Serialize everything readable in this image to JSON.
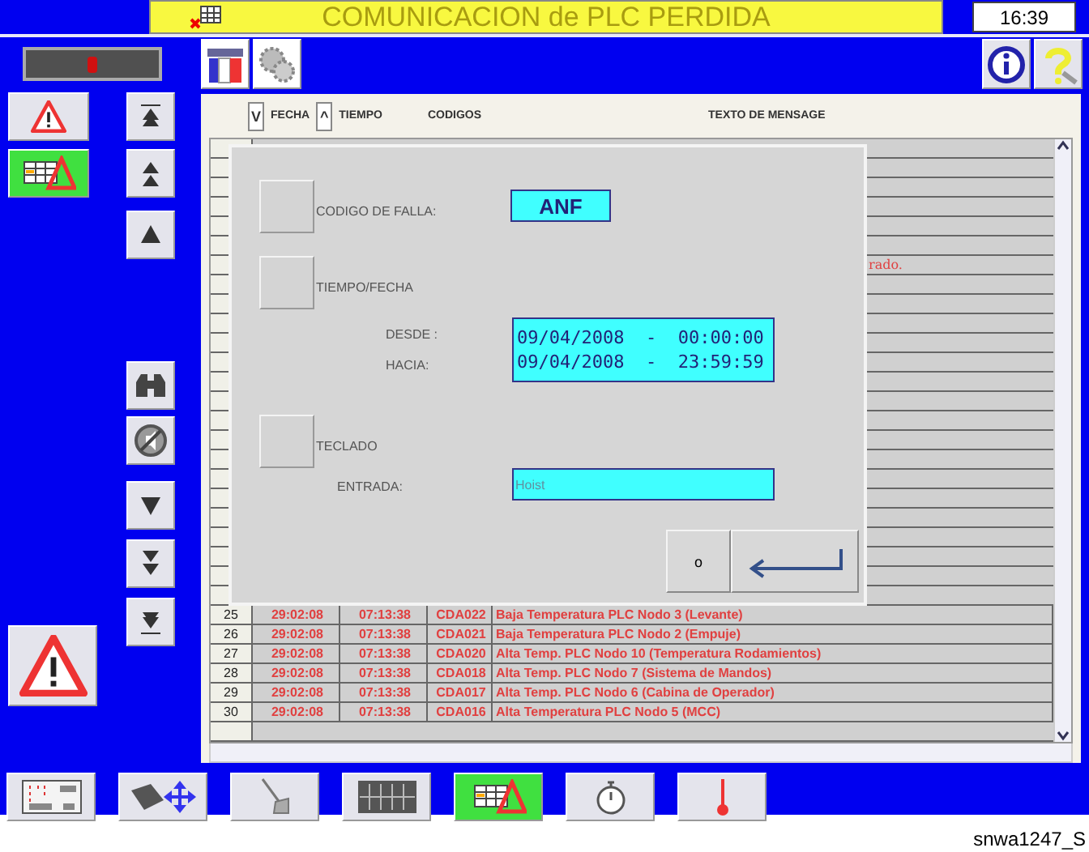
{
  "title_bar": {
    "title": "COMUNICACION de PLC PERDIDA",
    "clock": "16:39"
  },
  "nav": {
    "left": [
      {
        "kind": "warning",
        "selected": false
      },
      {
        "kind": "log",
        "selected": true
      }
    ],
    "arrows": [
      {
        "kind": "first"
      },
      {
        "kind": "page-up"
      },
      {
        "kind": "up"
      },
      {
        "kind": "binoculars"
      },
      {
        "kind": "mute"
      },
      {
        "kind": "down"
      },
      {
        "kind": "page-down"
      },
      {
        "kind": "last"
      }
    ],
    "alarm": {
      "kind": "big-warning"
    }
  },
  "toolbar": {
    "left": [
      {
        "kind": "flag"
      },
      {
        "kind": "gears"
      }
    ],
    "right": [
      {
        "kind": "info"
      },
      {
        "kind": "help"
      }
    ]
  },
  "table": {
    "columns": [
      {
        "sort": "V",
        "label": "FECHA"
      },
      {
        "sort": "^",
        "label": "TIEMPO"
      },
      {
        "label": "CODIGOS"
      },
      {
        "label": "TEXTO DE MENSAGE"
      }
    ],
    "obscured_tail": "rado.",
    "rows": [
      {
        "n": "25",
        "date": "29:02:08",
        "time": "07:13:38",
        "code": "CDA022",
        "text": "Baja Temperatura PLC Nodo 3 (Levante)"
      },
      {
        "n": "26",
        "date": "29:02:08",
        "time": "07:13:38",
        "code": "CDA021",
        "text": "Baja Temperatura PLC Nodo 2 (Empuje)"
      },
      {
        "n": "27",
        "date": "29:02:08",
        "time": "07:13:38",
        "code": "CDA020",
        "text": "Alta Temp. PLC Nodo 10 (Temperatura Rodamientos)"
      },
      {
        "n": "28",
        "date": "29:02:08",
        "time": "07:13:38",
        "code": "CDA018",
        "text": "Alta Temp. PLC Nodo 7 (Sistema de Mandos)"
      },
      {
        "n": "29",
        "date": "29:02:08",
        "time": "07:13:38",
        "code": "CDA017",
        "text": "Alta Temp. PLC Nodo 6 (Cabina de Operador)"
      },
      {
        "n": "30",
        "date": "29:02:08",
        "time": "07:13:38",
        "code": "CDA016",
        "text": "Alta Temperatura PLC Nodo 5 (MCC)"
      }
    ]
  },
  "dialog": {
    "filters": [
      {
        "kind": "code",
        "label": "CODIGO DE FALLA:",
        "checked": false,
        "value": "ANF"
      },
      {
        "kind": "datetime",
        "label": "TIEMPO/FECHA",
        "checked": false,
        "from_label": "DESDE :",
        "from": "09/04/2008  -  00:00:00",
        "to_label": "HACIA:",
        "to": "09/04/2008  -  23:59:59"
      },
      {
        "kind": "keyboard",
        "label": "TECLADO",
        "checked": false,
        "input_label": "ENTRADA:",
        "placeholder": "Hoist"
      }
    ],
    "buttons": [
      {
        "kind": "text",
        "label": "o"
      },
      {
        "kind": "enter"
      }
    ]
  },
  "bottom_bar": [
    {
      "kind": "panel",
      "selected": false
    },
    {
      "kind": "move",
      "selected": false
    },
    {
      "kind": "broom",
      "selected": false
    },
    {
      "kind": "rack",
      "selected": false
    },
    {
      "kind": "log",
      "selected": true
    },
    {
      "kind": "timer",
      "selected": false
    },
    {
      "kind": "thermometer",
      "selected": false
    }
  ],
  "caption": "snwa1247_S"
}
